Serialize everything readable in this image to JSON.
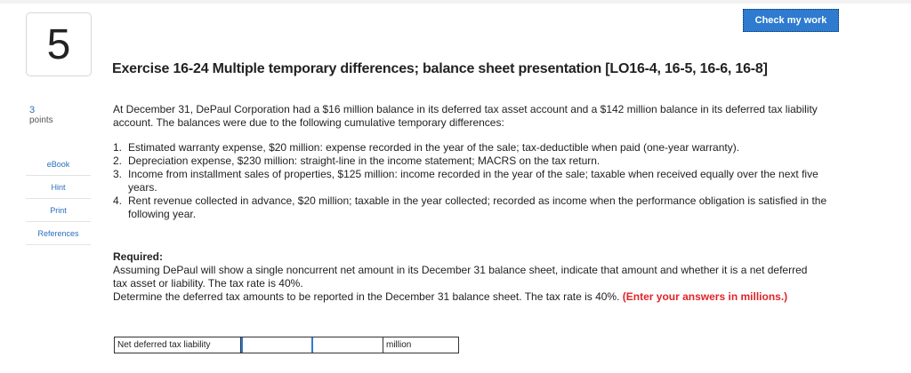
{
  "question": {
    "number": "5",
    "points_value": "3",
    "points_label": "points"
  },
  "sidebar": {
    "links": [
      "eBook",
      "Hint",
      "Print",
      "References"
    ]
  },
  "header": {
    "check_button": "Check my work"
  },
  "exercise": {
    "title": "Exercise 16-24 Multiple temporary differences; balance sheet presentation [LO16-4, 16-5, 16-6, 16-8]",
    "intro": "At December 31, DePaul Corporation had a $16 million balance in its deferred tax asset account and a $142 million balance in its deferred tax liability account. The balances were due to the following cumulative temporary differences:",
    "items": [
      {
        "num": "1.",
        "text": "Estimated warranty expense, $20 million: expense recorded in the year of the sale; tax-deductible when paid (one-year warranty)."
      },
      {
        "num": "2.",
        "text": "Depreciation expense, $230 million: straight-line in the income statement; MACRS on the tax return."
      },
      {
        "num": "3.",
        "text": "Income from installment sales of properties, $125 million: income recorded in the year of the sale; taxable when received equally over the next five years."
      },
      {
        "num": "4.",
        "text": "Rent revenue collected in advance, $20 million; taxable in the year collected; recorded as income when the performance obligation is satisfied in the following year."
      }
    ],
    "required_label": "Required:",
    "required_line1": "Assuming DePaul will show a single noncurrent net amount in its December 31 balance sheet, indicate that amount and whether it is a net deferred tax asset or liability. The tax rate is 40%.",
    "required_line2": "Determine the deferred tax amounts to be reported in the December 31 balance sheet. The tax rate is 40%.",
    "required_note": "(Enter your answers in millions.)"
  },
  "answer": {
    "label": "Net deferred tax liability",
    "value": "",
    "unit": "million"
  },
  "colors": {
    "accent": "#2e7bcf",
    "link": "#2a6ebb",
    "note_red": "#e0242a"
  }
}
